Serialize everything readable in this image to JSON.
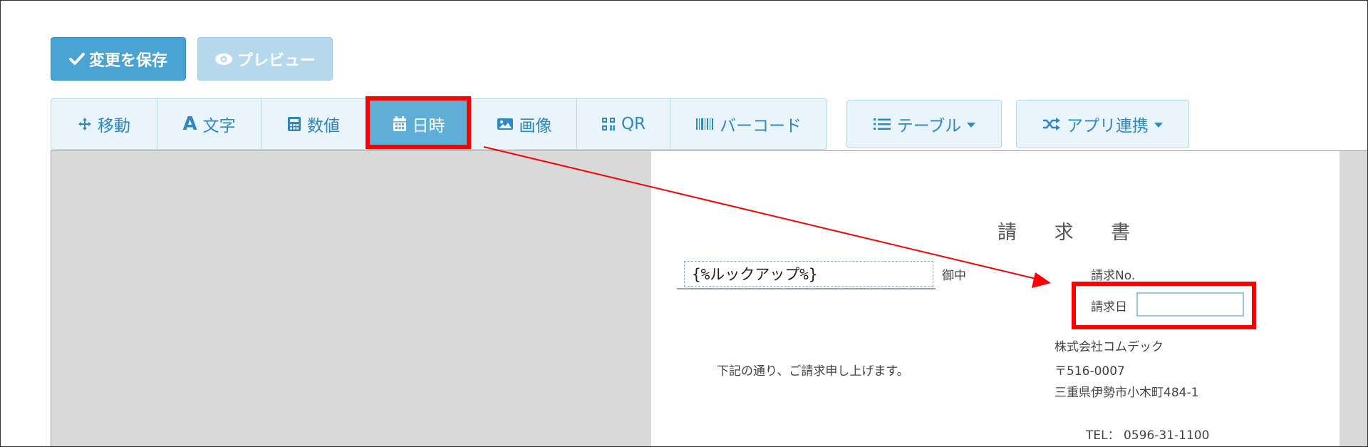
{
  "toolbar": {
    "save_label": "変更を保存",
    "preview_label": "プレビュー"
  },
  "tools": {
    "move": "移動",
    "text": "文字",
    "text_icon_letter": "A",
    "number": "数値",
    "datetime": "日時",
    "image": "画像",
    "qr": "QR",
    "barcode": "バーコード",
    "table": "テーブル",
    "app_link": "アプリ連携"
  },
  "invoice": {
    "title": "請 求 書",
    "lookup_placeholder": "{%ルックアップ%}",
    "honorific": "御中",
    "invoice_no_label": "請求No.",
    "invoice_date_label": "請求日",
    "greeting": "下記の通り、ご請求申し上げます。",
    "company_name": "株式会社コムデック",
    "postal_code": "〒516-0007",
    "address": "三重県伊勢市小木町484-1",
    "tel": "TEL： 0596-31-1100"
  },
  "colors": {
    "primary": "#4aa4d3",
    "primary_disabled": "#b5d8ed",
    "tool_text": "#2f88c4",
    "tool_bg": "#eaf4fb",
    "active_tool": "#5eaed8",
    "highlight": "#ff0000",
    "workspace_bg": "#d9d9d9"
  },
  "icons": {
    "save": "check-icon",
    "preview": "eye-icon",
    "move": "move-arrows-icon",
    "number": "calculator-icon",
    "datetime": "calendar-icon",
    "image": "image-icon",
    "qr": "qrcode-icon",
    "barcode": "barcode-icon",
    "table": "list-icon",
    "app_link": "shuffle-icon"
  },
  "annotation": {
    "active_tool": "datetime",
    "highlighted_field": "invoice_date"
  }
}
